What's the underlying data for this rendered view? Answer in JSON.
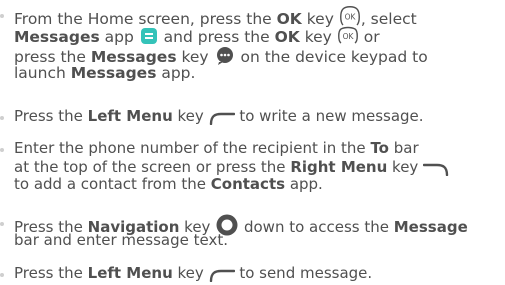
{
  "colors": {
    "text": "#505050",
    "bullet": "#cfcfcf",
    "messages_app_icon": "#34c3b9"
  },
  "steps": [
    {
      "lines": [
        {
          "t1": "From the Home screen, press the ",
          "b1": "OK",
          "t2": " key ",
          "t3": ", select"
        },
        {
          "b1": "Messages",
          "t1": " app ",
          "t2": " and press the ",
          "b2": "OK",
          "t3": " key ",
          "t4": " or"
        },
        {
          "t1": "press the ",
          "b1": "Messages",
          "t2": " key ",
          "t3": " on the device keypad to"
        },
        {
          "t1": "launch ",
          "b1": "Messages",
          "t2": " app."
        }
      ],
      "icons": {
        "ok_key_label": "OK",
        "ok_key_small_label": "OK"
      }
    },
    {
      "lines": [
        {
          "t1": "Press the ",
          "b1": "Left Menu",
          "t2": " key ",
          "t3": " to write a new message."
        }
      ]
    },
    {
      "lines": [
        {
          "t1": "Enter the phone number of the recipient in the ",
          "b1": "To",
          "t2": " bar"
        },
        {
          "t1": "at the top of the screen or press the ",
          "b1": "Right Menu",
          "t2": " key "
        },
        {
          "t1": "to add a contact from the ",
          "b1": "Contacts",
          "t2": " app."
        }
      ]
    },
    {
      "lines": [
        {
          "t1": "Press the ",
          "b1": "Navigation",
          "t2": " key ",
          "t3": " down to access the ",
          "b2": "Message"
        },
        {
          "t1": "bar and enter message text."
        }
      ]
    },
    {
      "lines": [
        {
          "t1": "Press the ",
          "b1": "Left Menu",
          "t2": " key ",
          "t3": " to send message."
        }
      ]
    }
  ]
}
